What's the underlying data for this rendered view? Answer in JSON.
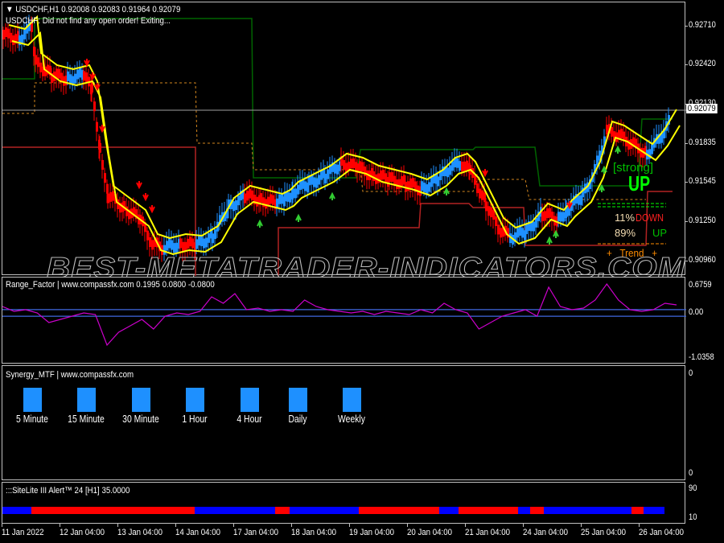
{
  "main_chart": {
    "symbol_header": "USDCHF,H1  0.92008 0.92083 0.91964 0.92079",
    "message": "USDCHF: Did not find any open order! Exiting...",
    "current_price": "0.92079",
    "price_axis": [
      "0.92710",
      "0.92420",
      "0.92130",
      "0.91835",
      "0.91545",
      "0.91250",
      "0.90960"
    ],
    "signal_panel": {
      "strength": "[strong]",
      "direction": "UP",
      "down_pct": "11%",
      "down_label": "DOWN",
      "up_pct": "89%",
      "up_label": "UP",
      "trend_label": "+   Trend   +"
    },
    "watermark": "BEST-METATRADER-INDICATORS.COM",
    "colors": {
      "bull": "#1e90ff",
      "bear": "#ff0000",
      "band": "#ffff00",
      "resistance": "#006400",
      "support": "#b22222",
      "mid": "#d2861e",
      "signal_green": "#00ff00",
      "signal_red": "#ff2020"
    }
  },
  "range_factor": {
    "title": "Range_Factor | www.compassfx.com   0.1995 0.0800 -0.0800",
    "axis": [
      "0.6759",
      "0.00",
      "-1.0358"
    ],
    "levels": [
      0.08,
      -0.08
    ],
    "line_color": "#cc00cc",
    "level_color": "#4169e1"
  },
  "synergy_mtf": {
    "title": "Synergy_MTF | www.compassfx.com",
    "axis": [
      "0",
      "0"
    ],
    "timeframes": [
      {
        "label": "5 Minute",
        "state": "up"
      },
      {
        "label": "15 Minute",
        "state": "up"
      },
      {
        "label": "30 Minute",
        "state": "up"
      },
      {
        "label": "1 Hour",
        "state": "up"
      },
      {
        "label": "4 Hour",
        "state": "up"
      },
      {
        "label": "Daily",
        "state": "up"
      },
      {
        "label": "Weekly",
        "state": "up"
      }
    ]
  },
  "sitelite": {
    "title": ":::SiteLite III Alert™ 24 [H1] 35.0000",
    "axis": [
      "90",
      "10"
    ],
    "segments": [
      {
        "color": "blue",
        "fraction": 0.043
      },
      {
        "color": "red",
        "fraction": 0.244
      },
      {
        "color": "blue",
        "fraction": 0.12
      },
      {
        "color": "red",
        "fraction": 0.021
      },
      {
        "color": "blue",
        "fraction": 0.103
      },
      {
        "color": "red",
        "fraction": 0.102
      },
      {
        "color": "red",
        "fraction": 0.018
      },
      {
        "color": "blue",
        "fraction": 0.029
      },
      {
        "color": "red",
        "fraction": 0.088
      },
      {
        "color": "blue",
        "fraction": 0.018
      },
      {
        "color": "red",
        "fraction": 0.021
      },
      {
        "color": "blue",
        "fraction": 0.131
      },
      {
        "color": "red",
        "fraction": 0.018
      },
      {
        "color": "blue",
        "fraction": 0.031
      }
    ]
  },
  "time_axis": [
    "11 Jan 2022",
    "12 Jan 04:00",
    "13 Jan 04:00",
    "14 Jan 04:00",
    "17 Jan 04:00",
    "18 Jan 04:00",
    "19 Jan 04:00",
    "20 Jan 04:00",
    "21 Jan 04:00",
    "24 Jan 04:00",
    "25 Jan 04:00",
    "26 Jan 04:00"
  ]
}
